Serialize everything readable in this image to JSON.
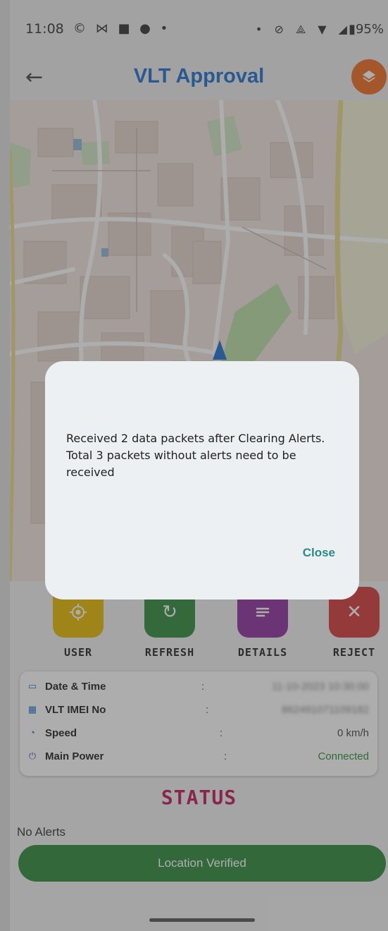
{
  "status_bar": {
    "time": "11:08",
    "left_icons": "© ⋈ ■ ●  •",
    "right_icons": "•  ⊘ ⟁ ▼ ◢",
    "battery": "95%"
  },
  "app_bar": {
    "back_icon": "back-arrow-icon",
    "title": "VLT Approval",
    "layers_icon": "layers-icon",
    "accent": "#f26b21",
    "title_color": "#1e6fd0"
  },
  "actions": [
    {
      "label": "USER",
      "icon": "target-icon",
      "color": "#e7b800"
    },
    {
      "label": "REFRESH",
      "icon": "refresh-icon",
      "color": "#2f8a3c"
    },
    {
      "label": "DETAILS",
      "icon": "list-icon",
      "color": "#8e2f9e"
    },
    {
      "label": "REJECT",
      "icon": "close-icon",
      "color": "#d63a3a"
    }
  ],
  "info": {
    "rows": [
      {
        "label": "Date & Time",
        "colon": ":",
        "value": "11-10-2023 10:30:00"
      },
      {
        "label": "VLT IMEI No",
        "colon": ":",
        "value": "862491071109182"
      },
      {
        "label": "Speed",
        "colon": ":",
        "value": "0 km/h"
      },
      {
        "label": "Main Power",
        "colon": ":",
        "value": "Connected"
      }
    ]
  },
  "status": {
    "heading": "STATUS",
    "alerts_text": "No Alerts",
    "verified_label": "Location Verified"
  },
  "dialog": {
    "message": "Received 2 data packets after Clearing Alerts. Total 3 packets without alerts need to be received",
    "close_label": "Close"
  }
}
